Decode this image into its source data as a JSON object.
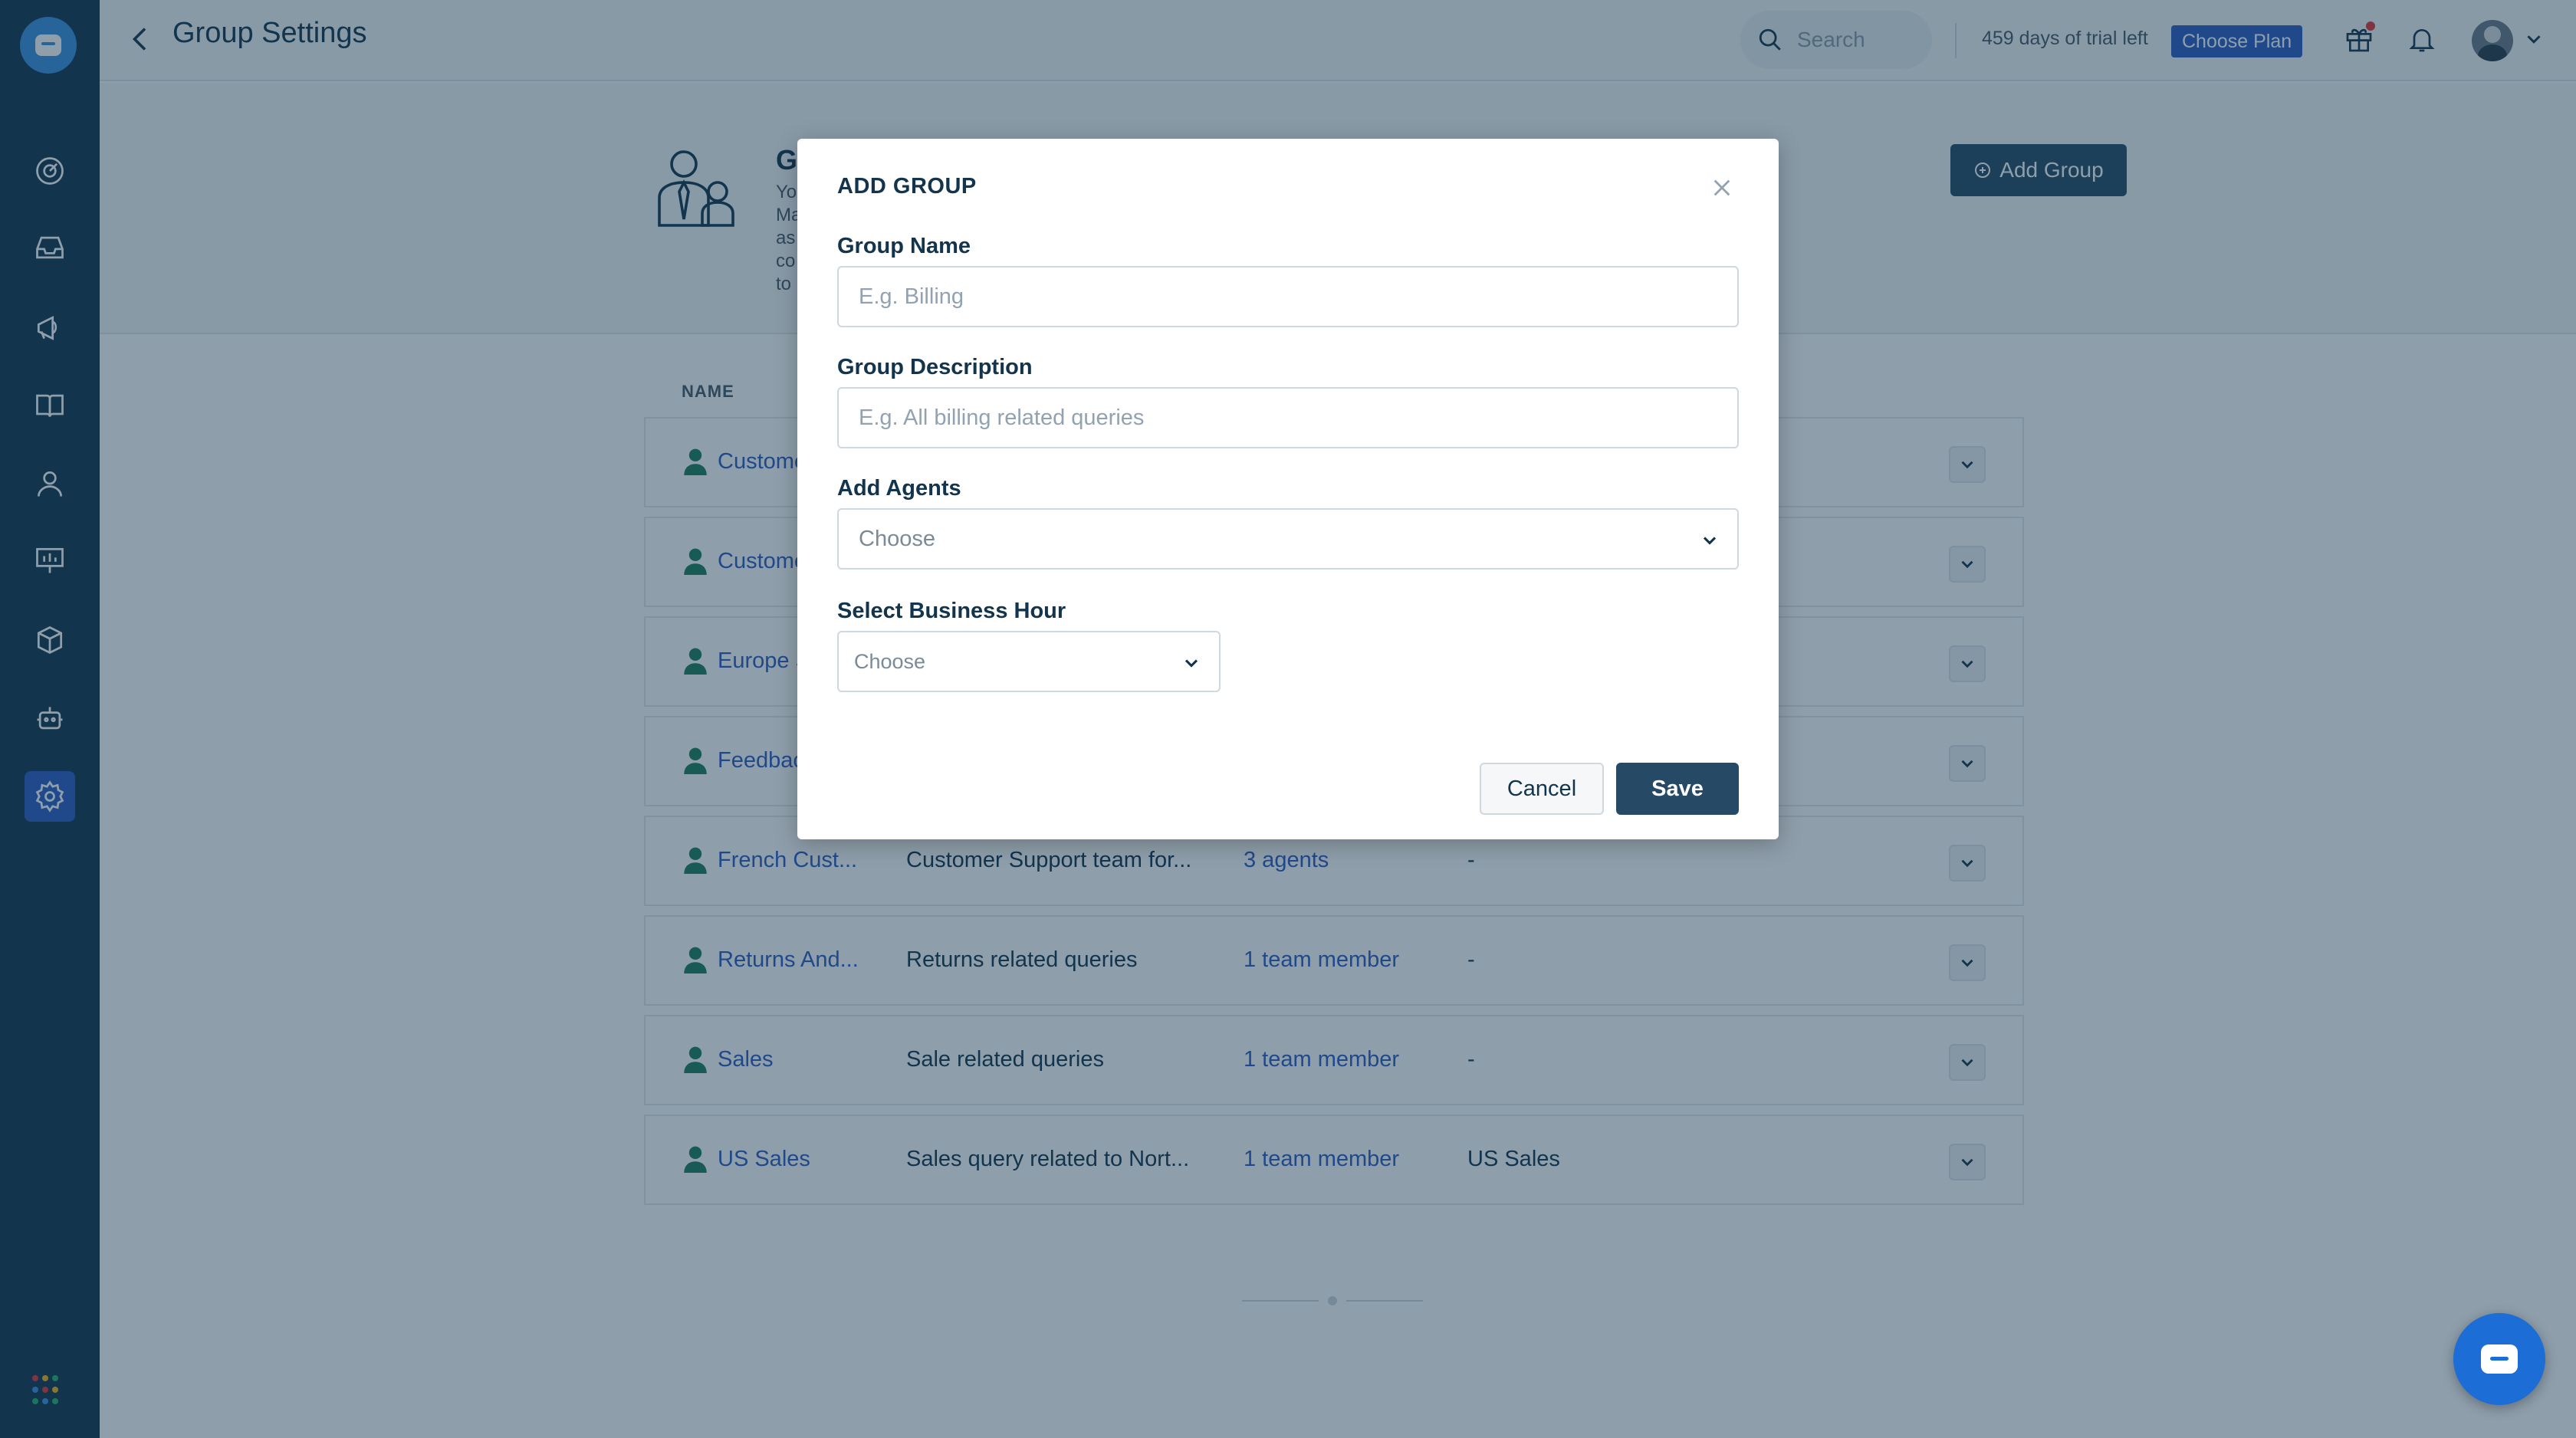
{
  "header": {
    "title": "Group Settings",
    "search_placeholder": "Search",
    "trial_text": "459 days of trial left",
    "choose_plan_label": "Choose Plan"
  },
  "banner": {
    "title": "G",
    "description": "Yo Ma as co to",
    "add_group_label": "Add Group"
  },
  "table": {
    "name_header": "NAME",
    "rows": [
      {
        "name": "Custome",
        "description": "",
        "agents": "",
        "business_hour": ""
      },
      {
        "name": "Custome",
        "description": "",
        "agents": "",
        "business_hour": ""
      },
      {
        "name": "Europe S",
        "description": "",
        "agents": "",
        "business_hour": ""
      },
      {
        "name": "Feedbac",
        "description": "",
        "agents": "",
        "business_hour": ""
      },
      {
        "name": "French Cust...",
        "description": "Customer Support team for...",
        "agents": "3 agents",
        "business_hour": "-"
      },
      {
        "name": "Returns And...",
        "description": "Returns related queries",
        "agents": "1 team member",
        "business_hour": "-"
      },
      {
        "name": "Sales",
        "description": "Sale related queries",
        "agents": "1 team member",
        "business_hour": "-"
      },
      {
        "name": "US Sales",
        "description": "Sales query related to Nort...",
        "agents": "1 team member",
        "business_hour": "US Sales"
      }
    ]
  },
  "modal": {
    "title": "ADD GROUP",
    "group_name_label": "Group Name",
    "group_name_placeholder": "E.g. Billing",
    "group_name_value": "",
    "group_description_label": "Group Description",
    "group_description_placeholder": "E.g. All billing related queries",
    "group_description_value": "",
    "add_agents_label": "Add Agents",
    "add_agents_value": "Choose",
    "business_hour_label": "Select Business Hour",
    "business_hour_value": "Choose",
    "cancel_label": "Cancel",
    "save_label": "Save"
  },
  "sidebar": {
    "items": [
      {
        "icon": "dashboard-icon"
      },
      {
        "icon": "inbox-icon"
      },
      {
        "icon": "campaigns-icon"
      },
      {
        "icon": "knowledge-base-icon"
      },
      {
        "icon": "contacts-icon"
      },
      {
        "icon": "reports-icon"
      },
      {
        "icon": "marketplace-icon"
      },
      {
        "icon": "bot-icon"
      },
      {
        "icon": "settings-icon",
        "active": true
      }
    ]
  },
  "colors": {
    "sidebar_bg": "#12344d",
    "accent": "#2c5cc5",
    "primary_button": "#264966",
    "overlay": "rgba(18,52,77,0.48)"
  }
}
